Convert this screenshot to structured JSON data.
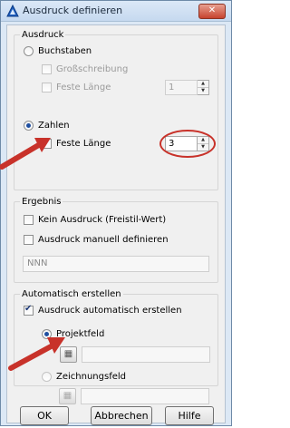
{
  "window": {
    "title": "Ausdruck definieren",
    "close_glyph": "✕"
  },
  "ausdruck": {
    "legend": "Ausdruck",
    "buchstaben": "Buchstaben",
    "grossschreibung": "Großschreibung",
    "feste_laenge_a": "Feste Länge",
    "feste_laenge_a_value": "1",
    "zahlen": "Zahlen",
    "feste_laenge_b": "Feste Länge",
    "feste_laenge_b_value": "3"
  },
  "ergebnis": {
    "legend": "Ergebnis",
    "kein_ausdruck": "Kein Ausdruck (Freistil-Wert)",
    "manuell": "Ausdruck manuell definieren",
    "field_value": "NNN"
  },
  "automatisch": {
    "legend": "Automatisch erstellen",
    "auto_check": "Ausdruck automatisch erstellen",
    "projektfeld": "Projektfeld",
    "zeichnungsfeld": "Zeichnungsfeld"
  },
  "buttons": {
    "ok": "OK",
    "abbrechen": "Abbrechen",
    "hilfe": "Hilfe"
  },
  "colors": {
    "annotation": "#c8322a",
    "title_bar": "#c6d9ef",
    "dialog_bg": "#f0f0f0"
  },
  "icons": {
    "app": "autocad-icon",
    "pick": "pick-field-icon"
  }
}
